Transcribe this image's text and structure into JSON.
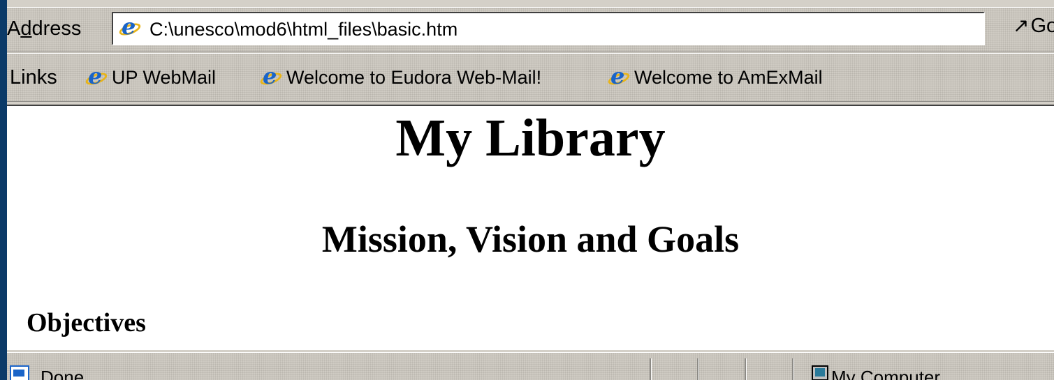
{
  "address_bar": {
    "label_prefix": "A",
    "label_underlined": "d",
    "label_suffix": "dress",
    "url": "C:\\unesco\\mod6\\html_files\\basic.htm",
    "go_label": "Go",
    "page_icon": "ie-page-icon",
    "dropdown_icon": "chevron-down-icon"
  },
  "links_bar": {
    "label": "Links",
    "items": [
      {
        "label": "UP WebMail",
        "icon": "ie-page-icon"
      },
      {
        "label": "Welcome to Eudora Web-Mail!",
        "icon": "ie-page-icon"
      },
      {
        "label": "Welcome to AmExMail",
        "icon": "ie-page-icon"
      }
    ]
  },
  "page": {
    "heading1": "My Library",
    "heading2": "Mission, Vision and Goals",
    "heading3": "Objectives"
  },
  "status_bar": {
    "status": "Done",
    "zone": "My Computer",
    "status_icon": "page-icon",
    "zone_icon": "computer-icon"
  },
  "colors": {
    "desktop": "#0b3a68",
    "chrome": "#d4d0c8",
    "content_bg": "#ffffff",
    "ie_blue": "#1a64c8",
    "ie_ring": "#e8b418"
  }
}
